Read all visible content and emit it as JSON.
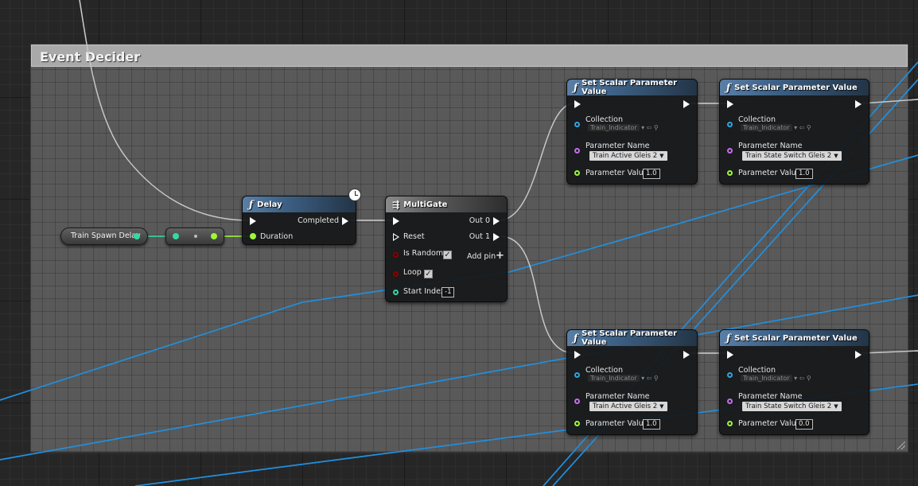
{
  "comment": {
    "title": "Event Decider"
  },
  "variable": {
    "label": "Train Spawn Delay"
  },
  "delay": {
    "title": "Delay",
    "completed_label": "Completed",
    "duration_label": "Duration"
  },
  "multigate": {
    "title": "MultiGate",
    "out0": "Out 0",
    "out1": "Out 1",
    "reset": "Reset",
    "is_random": "Is Random",
    "loop": "Loop",
    "start_index": "Start Index",
    "start_index_value": "-1",
    "add_pin": "Add pin",
    "add_pin_glyph": "+",
    "is_random_checked": true,
    "loop_checked": true
  },
  "ssp_nodes": [
    {
      "title": "Set Scalar Parameter Value",
      "collection_label": "Collection",
      "collection_value": "Train_Indicator",
      "param_name_label": "Parameter Name",
      "param_name_value": "Train Active Gleis 2",
      "param_value_label": "Parameter Value",
      "param_value": "1.0"
    },
    {
      "title": "Set Scalar Parameter Value",
      "collection_label": "Collection",
      "collection_value": "Train_Indicator",
      "param_name_label": "Parameter Name",
      "param_name_value": "Train State Switch Gleis 2",
      "param_value_label": "Parameter Value",
      "param_value": "1.0"
    },
    {
      "title": "Set Scalar Parameter Value",
      "collection_label": "Collection",
      "collection_value": "Train_Indicator",
      "param_name_label": "Parameter Name",
      "param_name_value": "Train Active Gleis 2",
      "param_value_label": "Parameter Value",
      "param_value": "1.0"
    },
    {
      "title": "Set Scalar Parameter Value",
      "collection_label": "Collection",
      "collection_value": "Train_Indicator",
      "param_name_label": "Parameter Name",
      "param_name_value": "Train State Switch Gleis 2",
      "param_value_label": "Parameter Value",
      "param_value": "0.0"
    }
  ],
  "icons": {
    "function": "function-icon",
    "multigate": "multigate-icon",
    "timer": "clock-icon",
    "dropdown": "chevron-down-icon",
    "browse": "arrow-left-icon",
    "search": "search-icon"
  },
  "colors": {
    "exec_wire": "#c8c8c8",
    "float_pin": "#9ef53b",
    "int_pin": "#36d8a5",
    "object_pin": "#2ca6e0",
    "name_pin": "#c86cf0",
    "bool_pin": "#8a0000",
    "blue_wire": "#1f8fe0"
  }
}
